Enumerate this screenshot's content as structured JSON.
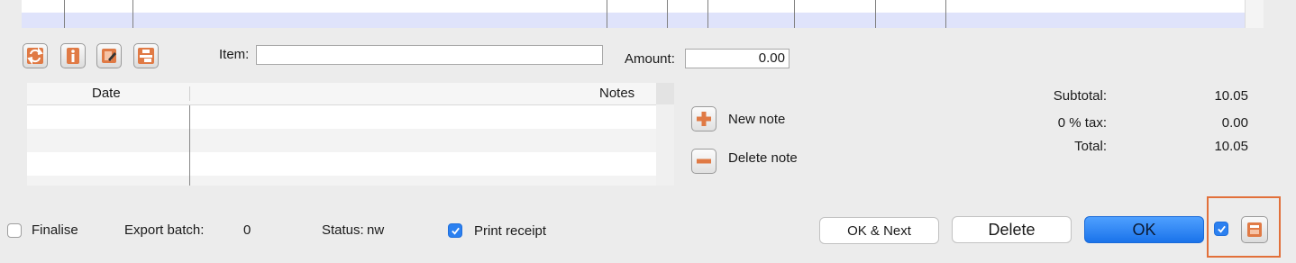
{
  "toolbar": {
    "icons": [
      "refresh-icon",
      "info-icon",
      "edit-document-icon",
      "transfer-icon"
    ],
    "item_label": "Item:",
    "item_value": "",
    "amount_label": "Amount:",
    "amount_value": "0.00"
  },
  "notes_table": {
    "columns": [
      "Date",
      "Notes"
    ],
    "rows": [],
    "new_note_label": "New note",
    "delete_note_label": "Delete note"
  },
  "totals": {
    "subtotal_label": "Subtotal:",
    "subtotal_value": "10.05",
    "tax_label": "0 % tax:",
    "tax_value": "0.00",
    "total_label": "Total:",
    "total_value": "10.05"
  },
  "footer": {
    "finalise_label": "Finalise",
    "finalise_checked": false,
    "export_batch_label": "Export batch:",
    "export_batch_value": "0",
    "status_label": "Status:",
    "status_value": "nw",
    "print_receipt_label": "Print receipt",
    "print_receipt_checked": true,
    "ok_next_label": "OK & Next",
    "delete_label": "Delete",
    "ok_label": "OK",
    "extra_checkbox_checked": true,
    "printer_icon": "printer-icon"
  },
  "colors": {
    "accent_blue": "#2b80f0",
    "highlight_orange": "#e2703a",
    "icon_orange": "#e07a45"
  }
}
